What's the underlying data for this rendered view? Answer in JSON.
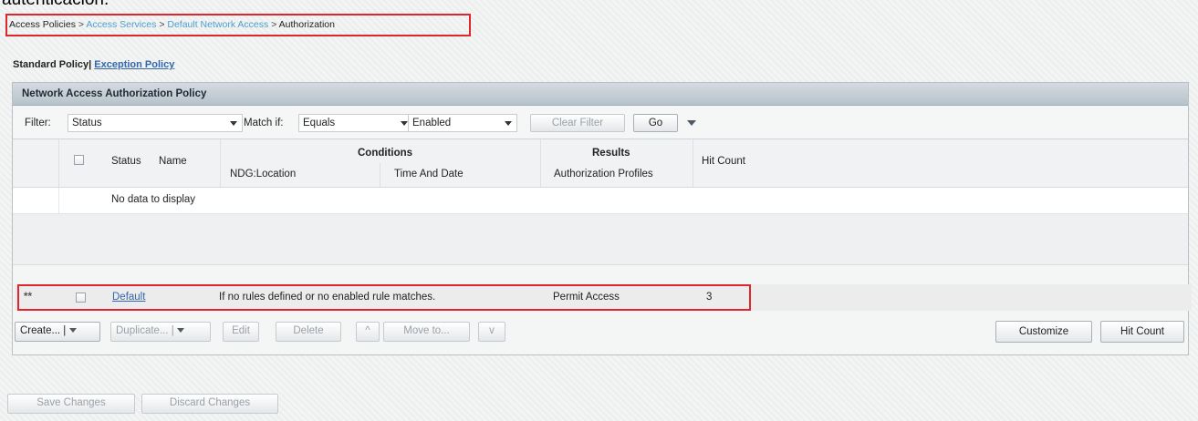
{
  "intro_text": "autenticación.",
  "breadcrumb": {
    "items": [
      {
        "label": "Access Policies",
        "style": "current"
      },
      {
        "label": "Access Services",
        "style": "link"
      },
      {
        "label": "Default Network Access",
        "style": "link"
      },
      {
        "label": "Authorization",
        "style": "current"
      }
    ],
    "separator": ">"
  },
  "policy_tabs": {
    "standard": "Standard Policy",
    "separator": "|",
    "exception": "Exception Policy"
  },
  "panel": {
    "title": "Network Access Authorization Policy",
    "filter": {
      "filter_label": "Filter:",
      "filter_value": "Status",
      "match_label": "Match if:",
      "match_value": "Equals",
      "state_value": "Enabled",
      "clear_label": "Clear Filter",
      "go_label": "Go"
    },
    "columns": {
      "status": "Status",
      "name": "Name",
      "conditions": "Conditions",
      "ndg_location": "NDG:Location",
      "time_and_date": "Time And Date",
      "results": "Results",
      "authorization_profiles": "Authorization Profiles",
      "hit_count": "Hit Count"
    },
    "empty_message": "No data to display",
    "default_rule": {
      "marker": "**",
      "name": "Default",
      "condition": "If no rules defined or no enabled rule matches.",
      "result": "Permit Access",
      "hit_count": "3"
    },
    "actions": {
      "create": "Create...",
      "duplicate": "Duplicate...",
      "edit": "Edit",
      "delete": "Delete",
      "move_up": "^",
      "move_to": "Move to...",
      "move_down": "v",
      "customize": "Customize",
      "hit_count": "Hit Count"
    }
  },
  "footer": {
    "save": "Save Changes",
    "discard": "Discard Changes"
  },
  "colors": {
    "highlight_border": "#e0262c",
    "link": "#3366aa",
    "breadcrumb_link": "#4c9fd2"
  }
}
